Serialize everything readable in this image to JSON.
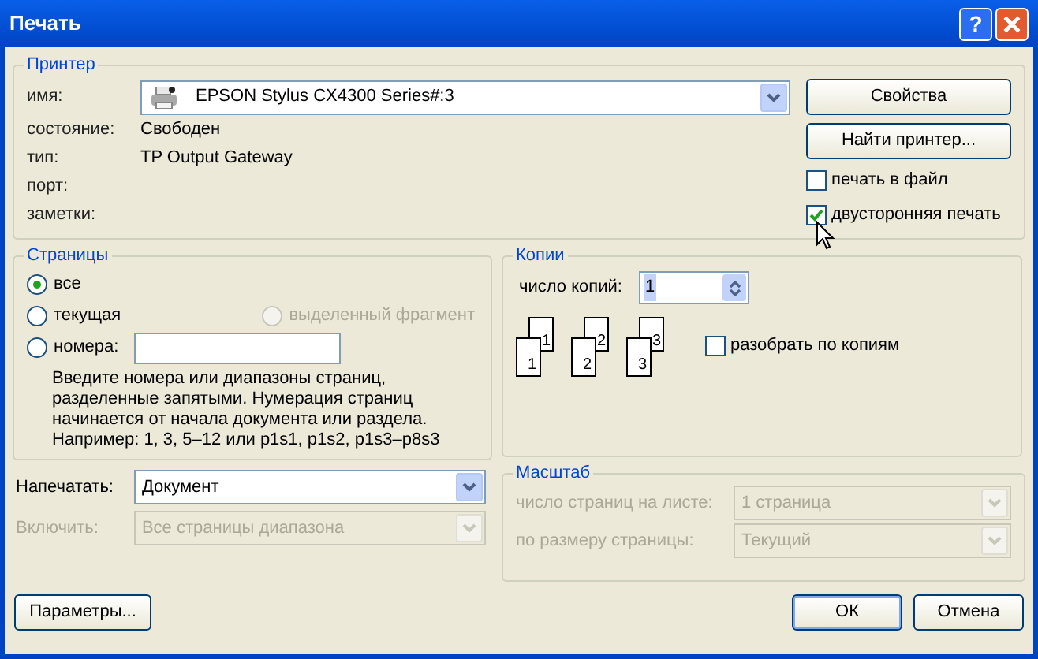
{
  "window": {
    "title": "Печать",
    "help": "?"
  },
  "printer": {
    "title": "Принтер",
    "name_label": "имя:",
    "name_value": "EPSON Stylus CX4300 Series#:3",
    "info": [
      {
        "label": "состояние:",
        "value": "Свободен"
      },
      {
        "label": "тип:",
        "value": "TP Output Gateway"
      },
      {
        "label": "порт:"
      },
      {
        "label": "заметки:"
      }
    ],
    "buttons": [
      "Свойства",
      "Найти принтер..."
    ],
    "options": [
      {
        "label": "печать в файл",
        "checked": false
      },
      {
        "label": "двусторонняя печать",
        "checked": true
      }
    ]
  },
  "pages": {
    "title": "Страницы",
    "options": [
      {
        "label": "все",
        "selected": true,
        "disabled": false
      },
      {
        "label": "текущая",
        "selected": false,
        "disabled": false
      },
      {
        "label": "выделенный фрагмент",
        "selected": false,
        "disabled": true
      },
      {
        "label": "номера:",
        "selected": false,
        "disabled": false
      }
    ],
    "hint": "Введите номера или диапазоны страниц, разделенные запятыми. Нумерация страниц начинается от начала документа или раздела. Например: 1, 3, 5–12 или p1s1, p1s2, p1s3–p8s3"
  },
  "copies": {
    "title": "Копии",
    "count_label": "число копий:",
    "count_value": "1",
    "sets": [
      {
        "back": "1",
        "front": "1"
      },
      {
        "back": "2",
        "front": "2"
      },
      {
        "back": "3",
        "front": "3"
      }
    ],
    "collate": {
      "label": "разобрать по копиям",
      "checked": false
    }
  },
  "selectors": [
    {
      "label": "Напечатать:",
      "value": "Документ",
      "disabled": false
    },
    {
      "label": "Включить:",
      "value": "Все страницы диапазона",
      "disabled": true
    }
  ],
  "scale": {
    "title": "Масштаб",
    "rows": [
      {
        "label": "число страниц на листе:",
        "value": "1 страница",
        "disabled": true
      },
      {
        "label": "по размеру страницы:",
        "value": "Текущий",
        "disabled": true
      }
    ]
  },
  "buttons": [
    {
      "label": "Параметры...",
      "default": false
    },
    {
      "label": "ОК",
      "default": true
    },
    {
      "label": "Отмена",
      "default": false
    }
  ]
}
